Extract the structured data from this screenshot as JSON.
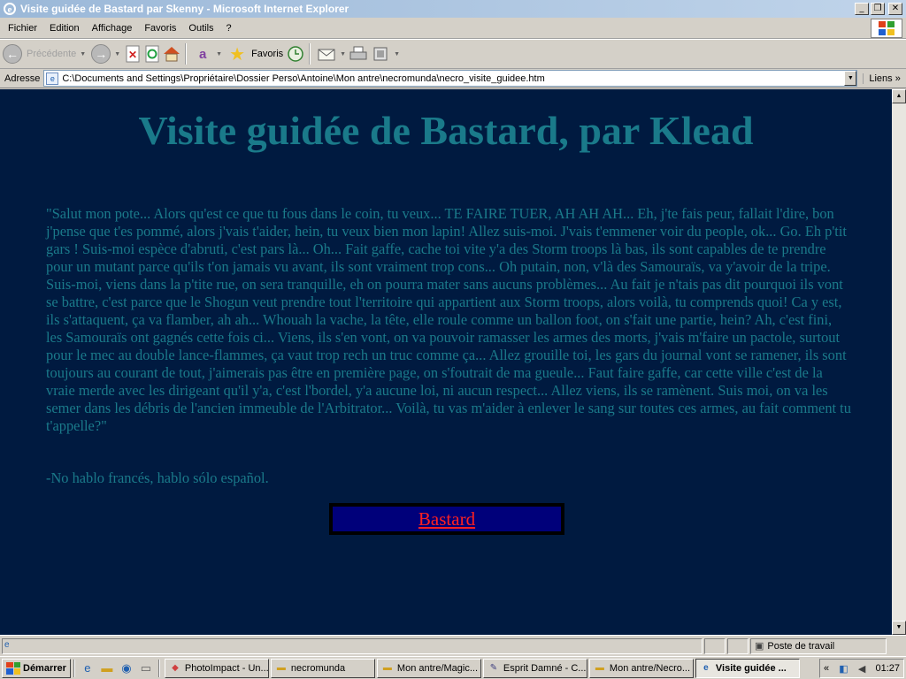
{
  "window": {
    "title": "Visite guidée de Bastard par Skenny - Microsoft Internet Explorer",
    "minimize": "_",
    "restore": "❐",
    "close": "✕"
  },
  "menu": {
    "items": [
      "Fichier",
      "Edition",
      "Affichage",
      "Favoris",
      "Outils",
      "?"
    ]
  },
  "toolbar": {
    "back_label": "Précédente",
    "favorites_label": "Favoris"
  },
  "address": {
    "label": "Adresse",
    "url": "C:\\Documents and Settings\\Propriétaire\\Dossier Perso\\Antoine\\Mon antre\\necromunda\\necro_visite_guidee.htm",
    "links_label": "Liens"
  },
  "page": {
    "heading": "Visite guidée de Bastard, par Klead",
    "body": "\"Salut mon pote... Alors qu'est ce que tu fous dans le coin, tu veux... TE FAIRE TUER, AH AH AH... Eh, j'te fais peur, fallait l'dire, bon j'pense que t'es pommé, alors j'vais t'aider, hein, tu veux bien mon lapin! Allez suis-moi. J'vais t'emmener voir du people, ok... Go. Eh p'tit gars ! Suis-moi espèce d'abruti, c'est pars là... Oh... Fait gaffe, cache toi vite y'a des Storm troops là bas, ils sont capables de te prendre pour un mutant parce qu'ils t'on jamais vu avant, ils sont vraiment trop cons... Oh putain, non, v'là des Samouraïs, va y'avoir de la tripe. Suis-moi, viens dans la p'tite rue, on sera tranquille, eh on pourra mater sans aucuns problèmes... Au fait je n'tais pas dit pourquoi ils vont se battre, c'est parce que le Shogun veut prendre tout l'territoire qui appartient aux Storm troops, alors voilà, tu comprends quoi! Ca y est, ils s'attaquent, ça va flamber, ah ah... Whouah la vache, la tête, elle roule comme un ballon foot, on s'fait une partie, hein? Ah, c'est fini, les Samouraïs ont gagnés cette fois ci... Viens, ils s'en vont, on va pouvoir ramasser les armes des morts, j'vais m'faire un pactole, surtout pour le mec au double lance-flammes, ça vaut trop rech un truc comme ça... Allez grouille toi, les gars du journal vont se ramener, ils sont toujours au courant de tout, j'aimerais pas être en première page, on s'foutrait de ma gueule... Faut faire gaffe, car cette ville c'est de la vraie merde avec les dirigeant qu'il y'a, c'est l'bordel, y'a aucune loi, ni aucun respect... Allez viens, ils se ramènent. Suis moi, on va les semer dans les débris de l'ancien immeuble de l'Arbitrator... Voilà, tu vas m'aider à enlever le sang sur toutes ces armes, au fait comment tu t'appelle?\"",
    "reply": "-No hablo francés, hablo sólo español.",
    "link_label": "Bastard"
  },
  "status": {
    "zone": "Poste de travail"
  },
  "taskbar": {
    "start": "Démarrer",
    "tasks": [
      "PhotoImpact - Un...",
      "necromunda",
      "Mon antre/Magic...",
      "Esprit Damné - C...",
      "Mon antre/Necro...",
      "Visite guidée ..."
    ],
    "tray_chevron": "«",
    "clock": "01:27"
  },
  "colors": {
    "page_background": "#001a40",
    "page_text": "#1a7a8a",
    "link": "#ff2020",
    "link_box": "#00007a"
  }
}
